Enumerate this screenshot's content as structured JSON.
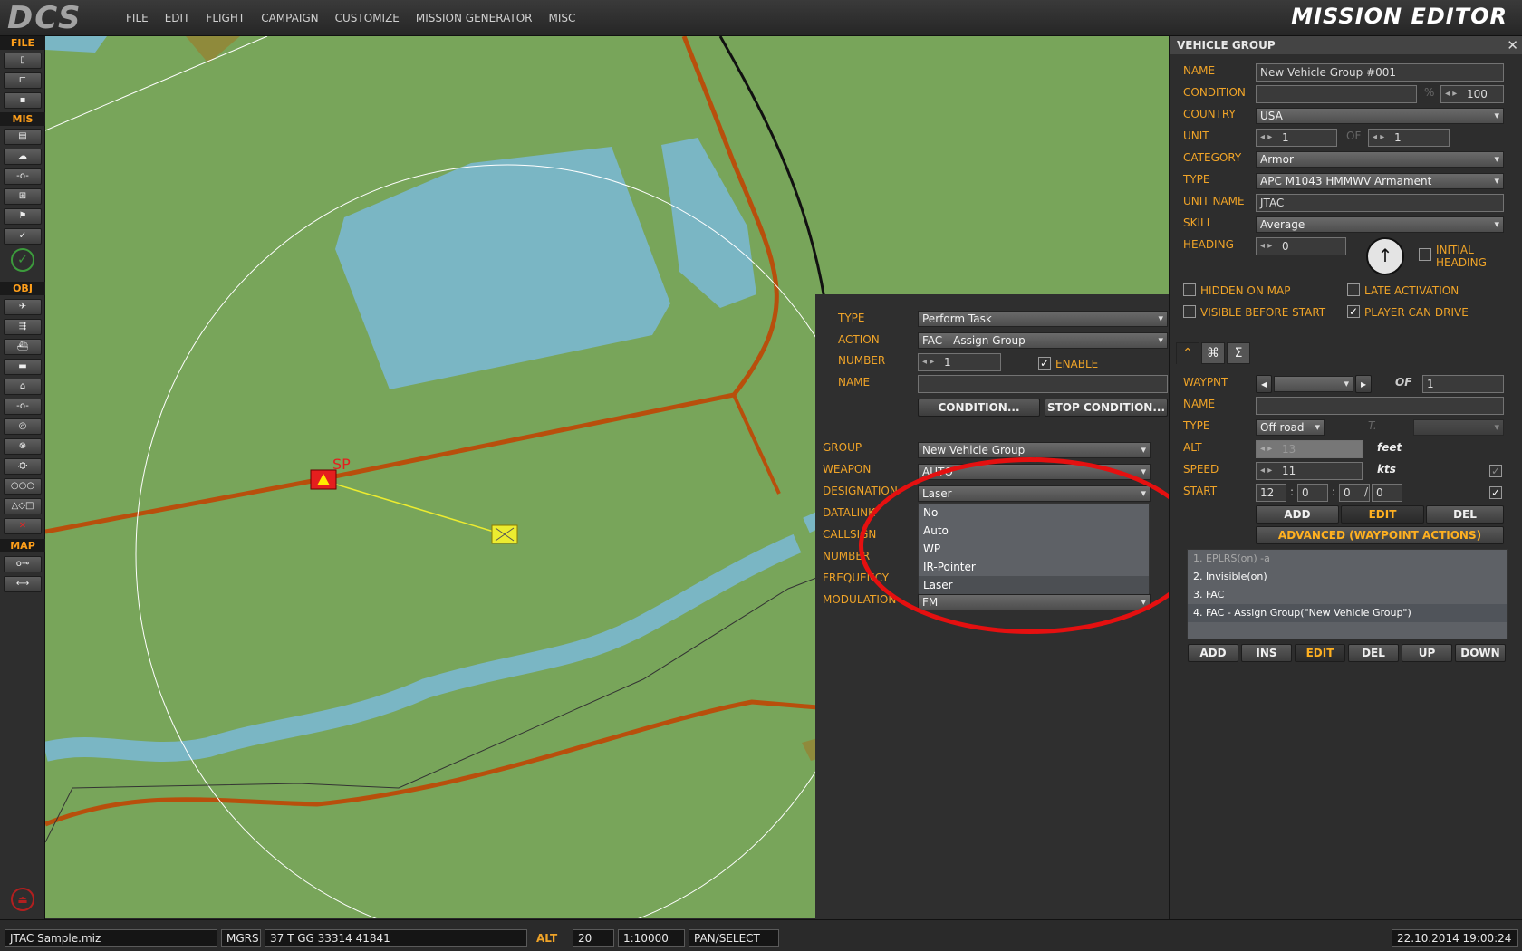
{
  "app": {
    "logo": "DCS",
    "title": "MISSION EDITOR"
  },
  "menu": [
    "FILE",
    "EDIT",
    "FLIGHT",
    "CAMPAIGN",
    "CUSTOMIZE",
    "MISSION GENERATOR",
    "MISC"
  ],
  "toolbar": {
    "sections": [
      "FILE",
      "MIS",
      "OBJ",
      "MAP"
    ]
  },
  "map": {
    "sp_label": "SP"
  },
  "vehicle_group": {
    "title": "VEHICLE GROUP",
    "close": "✕",
    "labels": {
      "name": "NAME",
      "condition": "CONDITION",
      "country": "COUNTRY",
      "unit": "UNIT",
      "category": "CATEGORY",
      "type": "TYPE",
      "unit_name": "UNIT NAME",
      "skill": "SKILL",
      "heading": "HEADING",
      "percent": "%",
      "of": "OF"
    },
    "name": "New Vehicle Group #001",
    "condition": "",
    "percent": "100",
    "country": "USA",
    "unit": "1",
    "unit_of": "1",
    "category": "Armor",
    "type": "APC M1043 HMMWV Armament",
    "unit_name": "JTAC",
    "skill": "Average",
    "heading": "0",
    "initial_heading": {
      "line1": "INITIAL",
      "line2": "HEADING",
      "checked": false
    },
    "checks": {
      "hidden_on_map": {
        "label": "HIDDEN ON MAP",
        "checked": false,
        "mark": ""
      },
      "late_activation": {
        "label": "LATE ACTIVATION",
        "checked": false,
        "mark": ""
      },
      "visible_before_start": {
        "label": "VISIBLE BEFORE START",
        "checked": false,
        "mark": ""
      },
      "player_can_drive": {
        "label": "PLAYER CAN DRIVE",
        "checked": true,
        "mark": "✓"
      }
    }
  },
  "route": {
    "labels": {
      "waypnt": "WAYPNT",
      "of": "OF",
      "name": "NAME",
      "type": "TYPE",
      "t": "T.",
      "alt": "ALT",
      "feet": "feet",
      "speed": "SPEED",
      "kts": "kts",
      "start": "START"
    },
    "waypnt": "",
    "waypnt_of": "1",
    "name": "",
    "type": "Off road",
    "alt": "13",
    "speed": "11",
    "start": {
      "h": "12",
      "m": "0",
      "s": "0",
      "d": "0",
      "sep1": ":",
      "sep2": ":",
      "sep3": "/",
      "check": "✓"
    },
    "speed_check": "✓",
    "buttons": {
      "add": "ADD",
      "edit": "EDIT",
      "del": "DEL",
      "advanced": "ADVANCED (WAYPOINT ACTIONS)"
    },
    "actions": [
      "1. EPLRS(on) -a",
      "2. Invisible(on)",
      "3. FAC",
      "4. FAC - Assign Group(\"New Vehicle Group\")"
    ],
    "action_buttons": [
      "ADD",
      "INS",
      "EDIT",
      "DEL",
      "UP",
      "DOWN"
    ]
  },
  "task": {
    "labels": {
      "type": "TYPE",
      "action": "ACTION",
      "number": "NUMBER",
      "name": "NAME",
      "enable": "ENABLE",
      "group": "GROUP",
      "weapon": "WEAPON",
      "designation": "DESIGNATION",
      "datalink": "DATALINK",
      "callsign": "CALLSIGN",
      "number2": "NUMBER",
      "frequency": "FREQUENCY",
      "modulation": "MODULATION"
    },
    "type": "Perform Task",
    "action": "FAC - Assign Group",
    "number": "1",
    "enable_mark": "✓",
    "name": "",
    "condition_btn": "CONDITION...",
    "stop_condition_btn": "STOP CONDITION...",
    "group": "New Vehicle Group",
    "weapon": "AUTO",
    "designation": "Laser",
    "designation_options": [
      "No",
      "Auto",
      "WP",
      "IR-Pointer",
      "Laser"
    ],
    "designation_selected": 4,
    "modulation": "FM"
  },
  "status": {
    "file": "JTAC Sample.miz",
    "coord_system": "MGRS",
    "coords": "37 T GG 33314 41841",
    "alt_label": "ALT",
    "alt": "20",
    "scale": "1:10000",
    "mode": "PAN/SELECT",
    "datetime": "22.10.2014 19:00:24"
  },
  "colors": {
    "accent": "#f0a428",
    "road": "#b84f0c",
    "water": "#7ab6c4",
    "terrain": "#78a55a",
    "highlight": "#e51010"
  }
}
